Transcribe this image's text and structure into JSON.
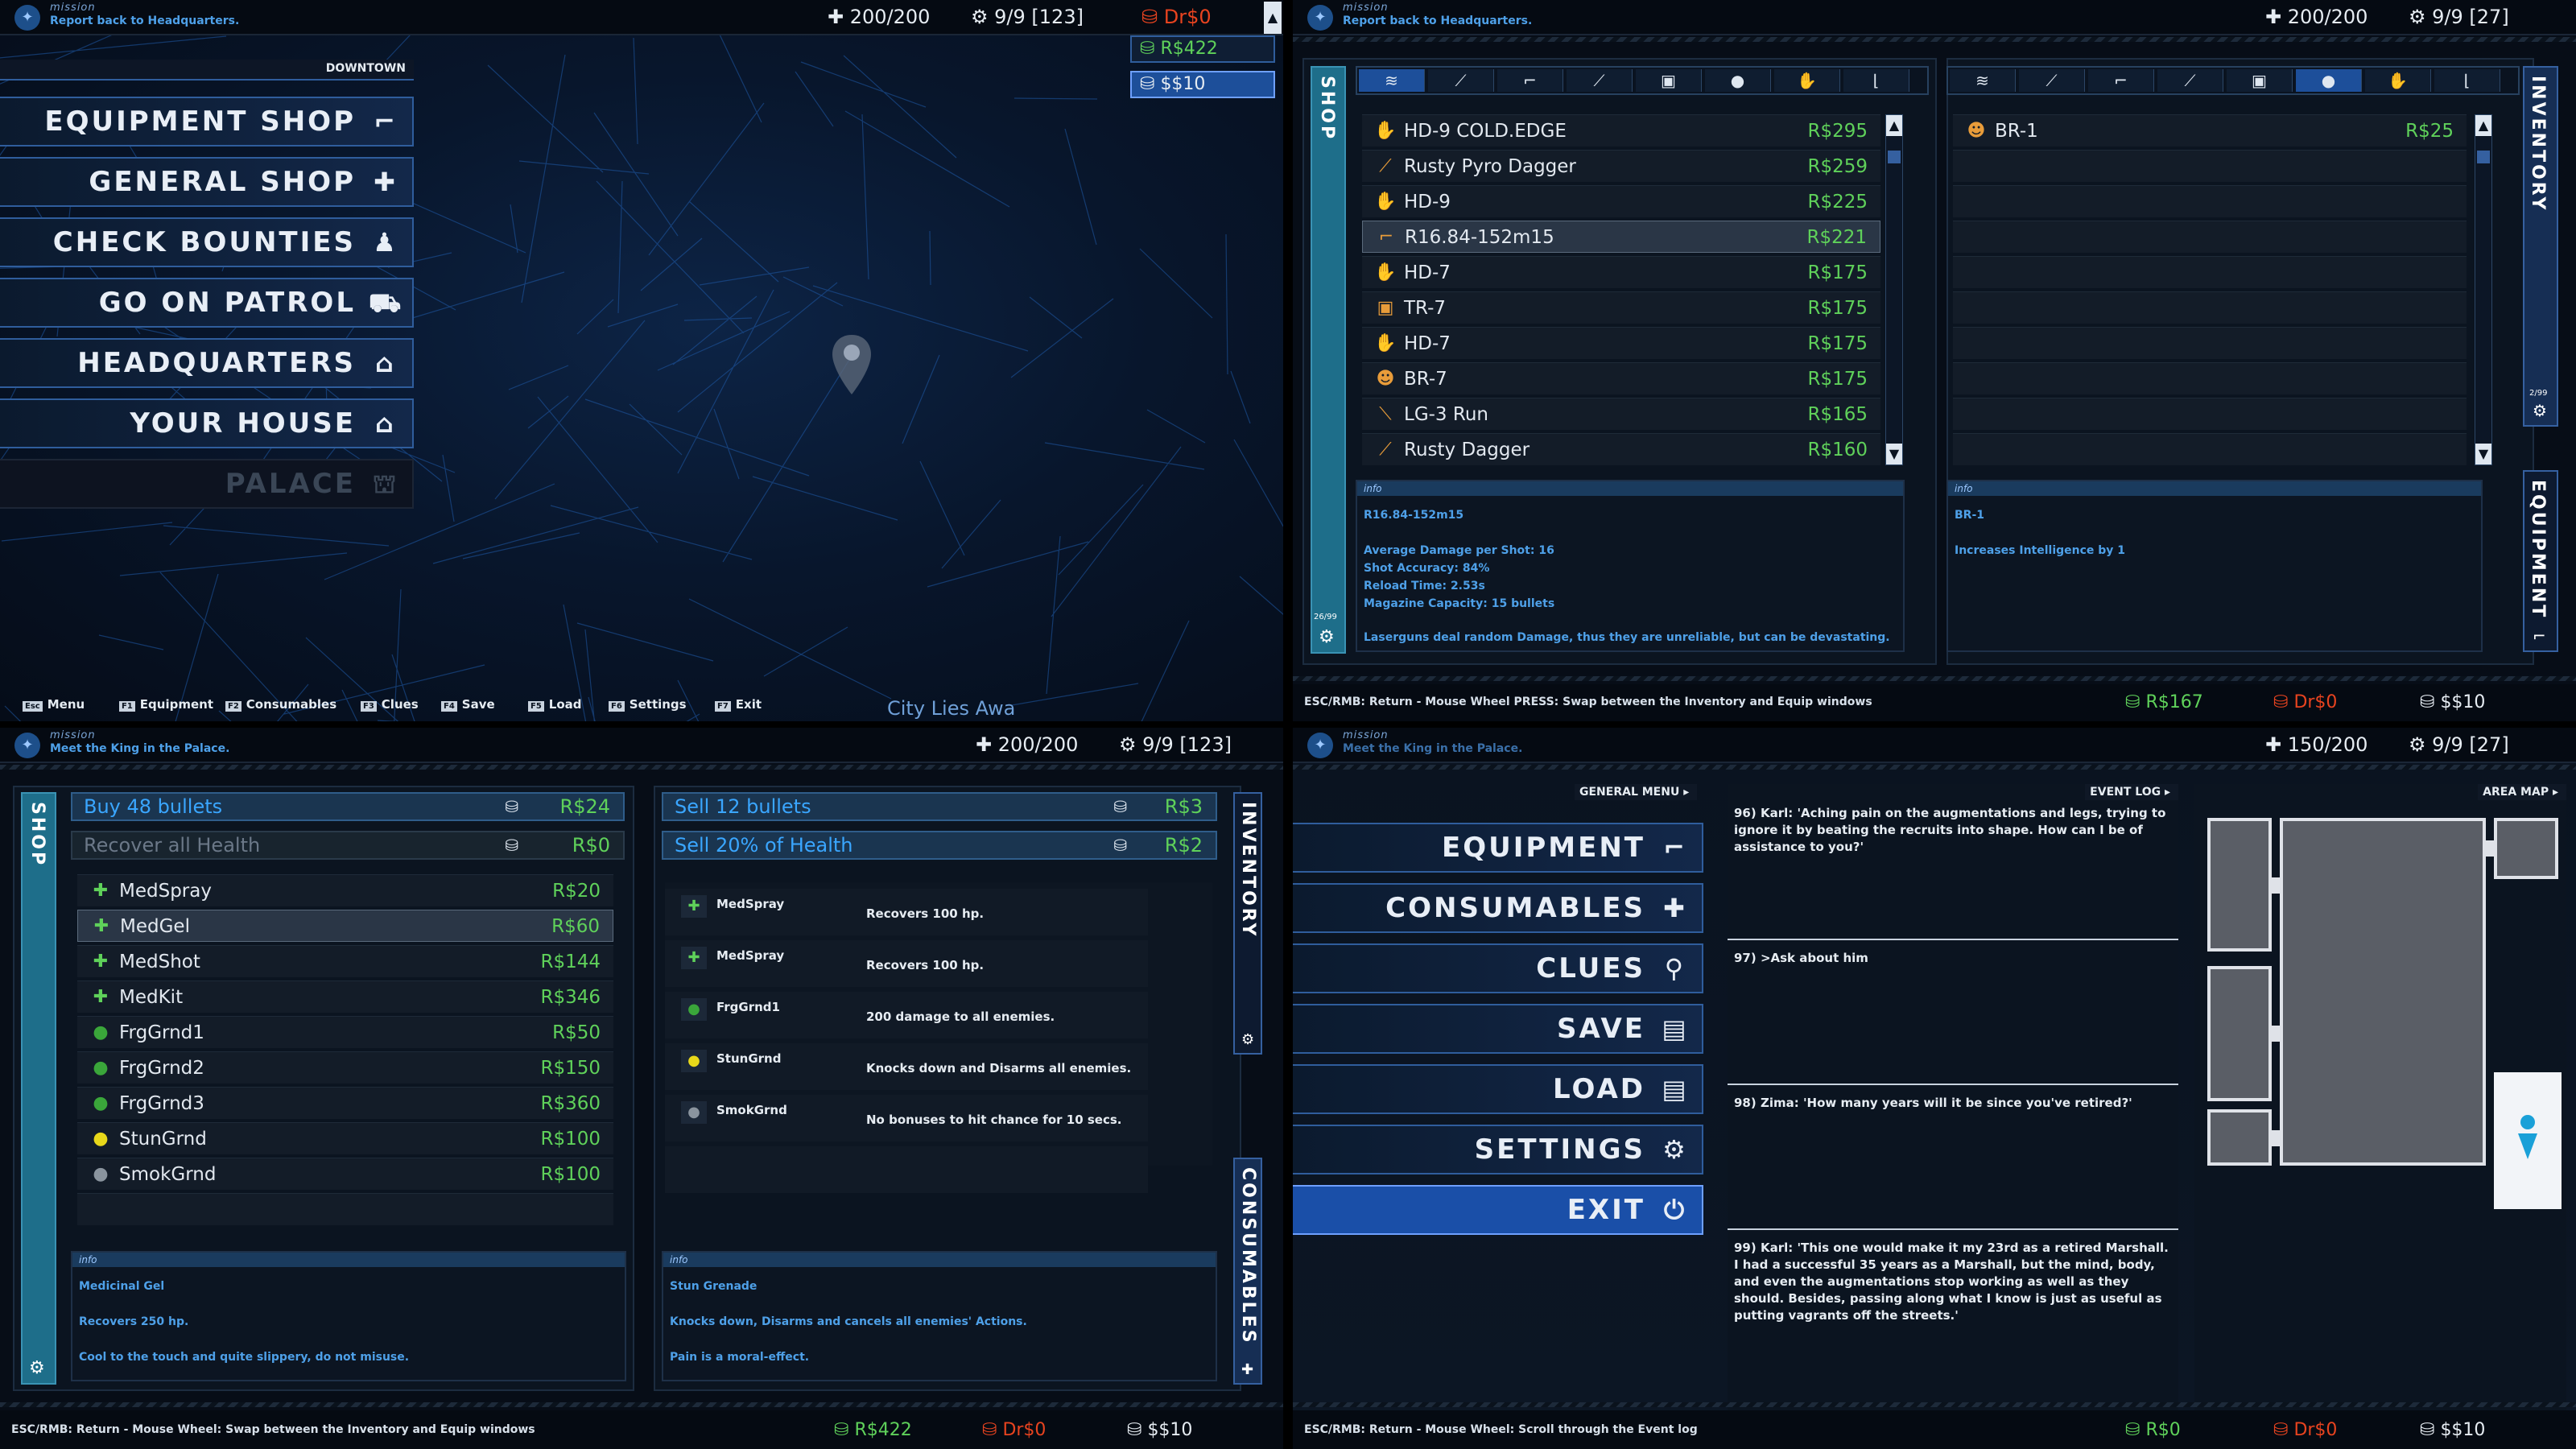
{
  "mission_label": "mission",
  "q1": {
    "mission_text": "Report back to Headquarters.",
    "health": "200/200",
    "squad": "9/9 [123]",
    "dr": "Dr$0",
    "r_wallet": "R$422",
    "s_wallet": "$$10",
    "location": "DOWNTOWN",
    "menu": [
      {
        "label": "EQUIPMENT SHOP",
        "icon": "pistol-icon",
        "glyph": "⌐"
      },
      {
        "label": "GENERAL SHOP",
        "icon": "medkit-icon",
        "glyph": "✚"
      },
      {
        "label": "CHECK BOUNTIES",
        "icon": "bounty-icon",
        "glyph": "♟"
      },
      {
        "label": "GO ON PATROL",
        "icon": "police-car-icon",
        "glyph": "⛟"
      },
      {
        "label": "HEADQUARTERS",
        "icon": "headquarters-icon",
        "glyph": "⌂"
      },
      {
        "label": "YOUR HOUSE",
        "icon": "house-icon",
        "glyph": "⌂"
      },
      {
        "label": "PALACE",
        "icon": "palace-icon",
        "glyph": "⛫"
      }
    ],
    "hotkeys": [
      {
        "key": "Esc",
        "label": "Menu"
      },
      {
        "key": "F1",
        "label": "Equipment"
      },
      {
        "key": "F2",
        "label": "Consumables"
      },
      {
        "key": "F3",
        "label": "Clues"
      },
      {
        "key": "F4",
        "label": "Save"
      },
      {
        "key": "F5",
        "label": "Load"
      },
      {
        "key": "F6",
        "label": "Settings"
      },
      {
        "key": "F7",
        "label": "Exit"
      }
    ],
    "footer_text": "City Lies Awa"
  },
  "q2": {
    "mission_text": "Report back to Headquarters.",
    "health": "200/200",
    "squad": "9/9 [27]",
    "shop_label": "SHOP",
    "shop_count": "26/99",
    "items": [
      {
        "name": "HD-9 COLD.EDGE",
        "price": "R$295",
        "icon": "gauntlet-icon",
        "glyph": "✋"
      },
      {
        "name": "Rusty Pyro Dagger",
        "price": "R$259",
        "icon": "dagger-icon",
        "glyph": "⟋"
      },
      {
        "name": "HD-9",
        "price": "R$225",
        "icon": "gauntlet-icon",
        "glyph": "✋"
      },
      {
        "name": "R16.84-152m15",
        "price": "R$221",
        "icon": "lasergun-icon",
        "glyph": "⌐"
      },
      {
        "name": "HD-7",
        "price": "R$175",
        "icon": "gauntlet-icon",
        "glyph": "✋"
      },
      {
        "name": "TR-7",
        "price": "R$175",
        "icon": "torso-icon",
        "glyph": "▣"
      },
      {
        "name": "HD-7",
        "price": "R$175",
        "icon": "gauntlet-icon",
        "glyph": "✋"
      },
      {
        "name": "BR-7",
        "price": "R$175",
        "icon": "brain-icon",
        "glyph": "☻"
      },
      {
        "name": "LG-3 Run",
        "price": "R$165",
        "icon": "leg-icon",
        "glyph": "⟍"
      },
      {
        "name": "Rusty Dagger",
        "price": "R$160",
        "icon": "dagger-icon",
        "glyph": "⟋"
      }
    ],
    "info_label": "info",
    "info_title": "R16.84-152m15",
    "info_lines": [
      "Average Damage per Shot: 16",
      "Shot Accuracy: 84%",
      "Reload Time: 2.53s",
      "Magazine Capacity: 15 bullets"
    ],
    "info_note": "Laserguns deal random Damage, thus they are unreliable, but can be devastating.",
    "inv_items": [
      {
        "name": "BR-1",
        "price": "R$25",
        "icon": "brain-icon",
        "glyph": "☻"
      }
    ],
    "inv_label": "INVENTORY",
    "inv_count": "2/99",
    "equip_label": "EQUIPMENT",
    "inv_info_title": "BR-1",
    "inv_info_text": "Increases Intelligence by 1",
    "hint": "ESC/RMB: Return - Mouse Wheel PRESS: Swap between the Inventory and Equip windows",
    "r_wallet": "R$167",
    "dr": "Dr$0",
    "s_wallet": "$$10"
  },
  "q3": {
    "mission_text": "Meet the King in the Palace.",
    "health": "200/200",
    "squad": "9/9 [123]",
    "shop_label": "SHOP",
    "buy_bullets": "Buy 48 bullets",
    "buy_bullets_price": "R$24",
    "recover": "Recover all Health",
    "recover_price": "R$0",
    "items": [
      {
        "name": "MedSpray",
        "price": "R$20",
        "icon": "medspray-icon",
        "glyph": "✚"
      },
      {
        "name": "MedGel",
        "price": "R$60",
        "icon": "medgel-icon",
        "glyph": "✚"
      },
      {
        "name": "MedShot",
        "price": "R$144",
        "icon": "medshot-icon",
        "glyph": "✚"
      },
      {
        "name": "MedKit",
        "price": "R$346",
        "icon": "medkit-icon",
        "glyph": "✚"
      },
      {
        "name": "FrgGrnd1",
        "price": "R$50",
        "icon": "grenade-icon",
        "glyph": "●"
      },
      {
        "name": "FrgGrnd2",
        "price": "R$150",
        "icon": "grenade-icon",
        "glyph": "●"
      },
      {
        "name": "FrgGrnd3",
        "price": "R$360",
        "icon": "grenade-icon",
        "glyph": "●"
      },
      {
        "name": "StunGrnd",
        "price": "R$100",
        "icon": "stun-grenade-icon",
        "glyph": "●"
      },
      {
        "name": "SmokGrnd",
        "price": "R$100",
        "icon": "smoke-grenade-icon",
        "glyph": "●"
      }
    ],
    "info_label": "info",
    "info_title": "Medicinal Gel",
    "info_line": "Recovers 250 hp.",
    "info_note": "Cool to the touch and quite slippery, do not misuse.",
    "sell_bullets": "Sell 12 bullets",
    "sell_bullets_price": "R$3",
    "sell_health": "Sell 20% of Health",
    "sell_health_price": "R$2",
    "consumables": [
      {
        "name": "MedSpray",
        "desc": "Recovers 100 hp.",
        "icon": "medspray-icon",
        "glyph": "✚"
      },
      {
        "name": "MedSpray",
        "desc": "Recovers 100 hp.",
        "icon": "medspray-icon",
        "glyph": "✚"
      },
      {
        "name": "FrgGrnd1",
        "desc": "200 damage to all enemies.",
        "icon": "grenade-icon",
        "glyph": "●"
      },
      {
        "name": "StunGrnd",
        "desc": "Knocks down and Disarms all enemies.",
        "icon": "stun-grenade-icon",
        "glyph": "●"
      },
      {
        "name": "SmokGrnd",
        "desc": "No bonuses to hit chance for 10 secs.",
        "icon": "smoke-grenade-icon",
        "glyph": "●"
      }
    ],
    "inv_label": "INVENTORY",
    "cons_label": "CONSUMABLES",
    "inv_info_title": "Stun Grenade",
    "inv_info_line": "Knocks down, Disarms and cancels all enemies' Actions.",
    "inv_info_note": "Pain is a moral-effect.",
    "hint": "ESC/RMB: Return - Mouse Wheel: Swap between the Inventory and Equip windows",
    "r_wallet": "R$422",
    "dr": "Dr$0",
    "s_wallet": "$$10"
  },
  "q4": {
    "mission_text": "Meet the King in the Palace.",
    "health": "150/200",
    "squad": "9/9 [27]",
    "general_menu": "GENERAL MENU",
    "event_log": "EVENT LOG",
    "area_map": "AREA MAP",
    "menu": [
      {
        "label": "EQUIPMENT",
        "icon": "pistol-icon",
        "glyph": "⌐"
      },
      {
        "label": "CONSUMABLES",
        "icon": "medkit-icon",
        "glyph": "✚"
      },
      {
        "label": "CLUES",
        "icon": "magnifier-icon",
        "glyph": "⚲"
      },
      {
        "label": "SAVE",
        "icon": "save-icon",
        "glyph": "▤"
      },
      {
        "label": "LOAD",
        "icon": "load-icon",
        "glyph": "▤"
      },
      {
        "label": "SETTINGS",
        "icon": "gear-icon",
        "glyph": "⚙"
      },
      {
        "label": "EXIT",
        "icon": "power-icon",
        "glyph": "⏻"
      }
    ],
    "log": [
      "96) Karl: 'Aching pain on the augmentations and legs, trying to ignore it by beating the recruits into shape. How can I be of assistance to you?'",
      "97) >Ask about him",
      "98) Zima: 'How many years will it be since you've retired?'",
      "99) Karl: 'This one would make it my 23rd as a retired Marshall. I had a successful 35 years as a Marshall, but the mind, body, and even the augmentations stop working as well as they should. Besides, passing along what I know is just as useful as putting vagrants off the streets.'"
    ],
    "hint": "ESC/RMB: Return - Mouse Wheel: Scroll through the Event log",
    "r_wallet": "R$0",
    "dr": "Dr$0",
    "s_wallet": "$$10"
  }
}
